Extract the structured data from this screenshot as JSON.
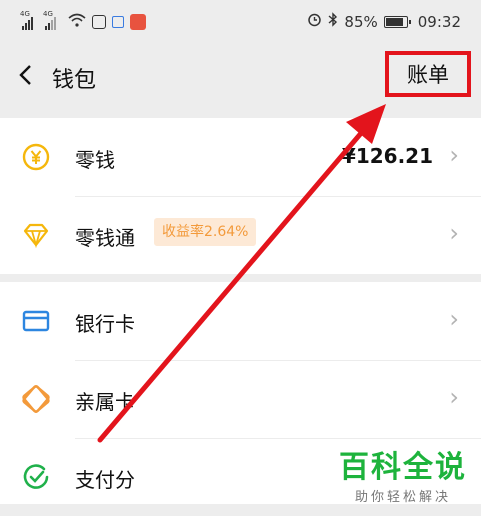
{
  "status_bar": {
    "signal1": "4G",
    "signal2": "4G",
    "alarm_icon": "alarm-icon",
    "bluetooth_icon": "bluetooth-icon",
    "battery": "85%",
    "time": "09:32"
  },
  "nav": {
    "title": "钱包",
    "bill_label": "账单"
  },
  "items": [
    {
      "label": "零钱",
      "value": "¥126.21",
      "icon": "yen-coin-icon",
      "color": "#f5b70c"
    },
    {
      "label": "零钱通",
      "badge": "收益率2.64%",
      "icon": "diamond-icon",
      "color": "#f5b70c"
    },
    {
      "label": "银行卡",
      "icon": "card-icon",
      "color": "#2d86e0"
    },
    {
      "label": "亲属卡",
      "icon": "family-card-icon",
      "color": "#f39a3b"
    },
    {
      "label": "支付分",
      "icon": "pay-score-icon",
      "color": "#20b14b"
    }
  ],
  "chevron": "›",
  "watermark": {
    "title": "百科全说",
    "subtitle": "助你轻松解决"
  },
  "colors": {
    "highlight_red": "#e3141c",
    "arrow_red": "#e3141c",
    "badge_bg": "#fde9d6",
    "badge_text": "#f39a3b"
  }
}
